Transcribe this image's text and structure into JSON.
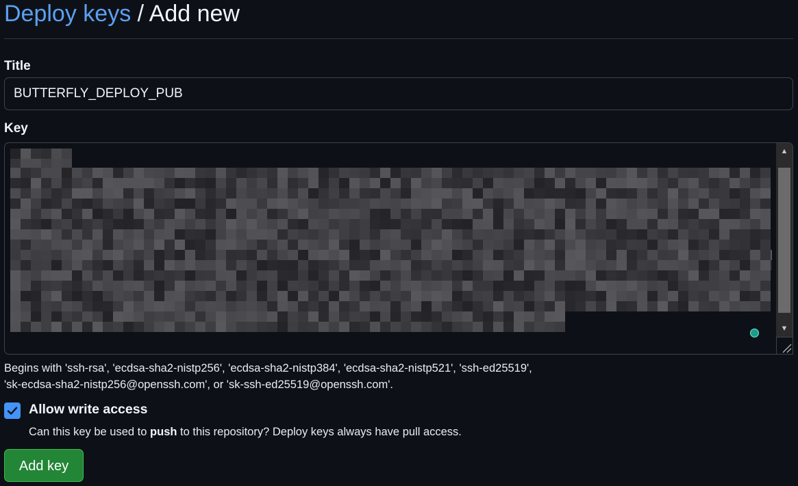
{
  "header": {
    "breadcrumb_link": "Deploy keys",
    "separator": " / ",
    "current": "Add new"
  },
  "form": {
    "title_label": "Title",
    "title_value": "BUTTERFLY_DEPLOY_PUB",
    "key_label": "Key",
    "key_hint_line1": "Begins with 'ssh-rsa', 'ecdsa-sha2-nistp256', 'ecdsa-sha2-nistp384', 'ecdsa-sha2-nistp521', 'ssh-ed25519',",
    "key_hint_line2": "'sk-ecdsa-sha2-nistp256@openssh.com', or 'sk-ssh-ed25519@openssh.com'.",
    "allow_write": {
      "checked": true,
      "label": "Allow write access",
      "desc_before": "Can this key be used to ",
      "desc_bold": "push",
      "desc_after": " to this repository? Deploy keys always have pull access."
    },
    "submit_label": "Add key"
  },
  "colors": {
    "background": "#0d1117",
    "link": "#5ca0f2",
    "primary_button": "#238636",
    "checkbox": "#4493f8"
  },
  "icons": {
    "check": "checkmark-icon",
    "scroll_up": "scroll-up-icon",
    "scroll_down": "scroll-down-icon",
    "resize": "resize-grip-icon",
    "status": "status-dot-icon"
  }
}
